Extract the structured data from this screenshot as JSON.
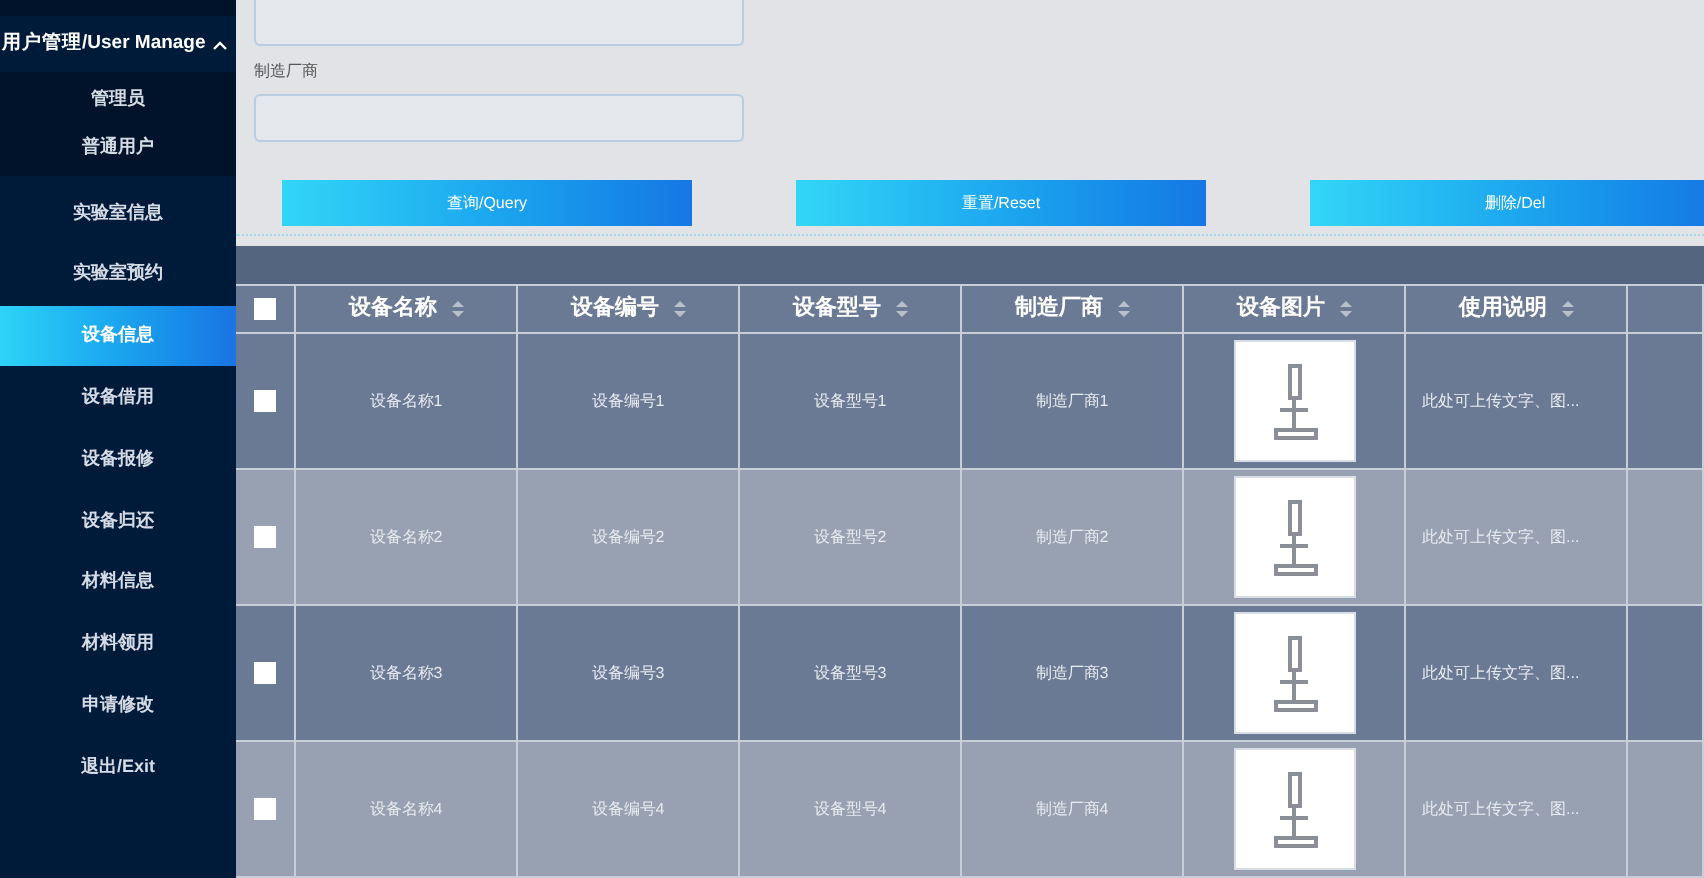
{
  "sidebar": {
    "group": {
      "label": "用户管理/User Manage",
      "expanded": true,
      "children": [
        {
          "label": "管理员",
          "selected": false
        },
        {
          "label": "普通用户",
          "selected": false
        }
      ]
    },
    "items": [
      {
        "label": "实验室信息",
        "selected": false
      },
      {
        "label": "实验室预约",
        "selected": false
      },
      {
        "label": "设备信息",
        "selected": true
      },
      {
        "label": "设备借用",
        "selected": false
      },
      {
        "label": "设备报修",
        "selected": false
      },
      {
        "label": "设备归还",
        "selected": false
      },
      {
        "label": "材料信息",
        "selected": false
      },
      {
        "label": "材料领用",
        "selected": false
      },
      {
        "label": "申请修改",
        "selected": false
      },
      {
        "label": "退出/Exit",
        "selected": false
      }
    ]
  },
  "search_form": {
    "field_label": "制造厂商",
    "buttons": [
      "查询/Query",
      "重置/Reset",
      "删除/Del"
    ]
  },
  "table": {
    "select_all_checked": false,
    "columns": [
      "设备名称",
      "设备编号",
      "设备型号",
      "制造厂商",
      "设备图片",
      "使用说明"
    ],
    "rows": [
      {
        "checked": false,
        "cells": [
          "设备名称1",
          "设备编号1",
          "设备型号1",
          "制造厂商1"
        ],
        "description": "此处可上传文字、图..."
      },
      {
        "checked": false,
        "cells": [
          "设备名称2",
          "设备编号2",
          "设备型号2",
          "制造厂商2"
        ],
        "description": "此处可上传文字、图..."
      },
      {
        "checked": false,
        "cells": [
          "设备名称3",
          "设备编号3",
          "设备型号3",
          "制造厂商3"
        ],
        "description": "此处可上传文字、图..."
      },
      {
        "checked": false,
        "cells": [
          "设备名称4",
          "设备编号4",
          "设备型号4",
          "制造厂商4"
        ],
        "description": "此处可上传文字、图..."
      }
    ]
  }
}
